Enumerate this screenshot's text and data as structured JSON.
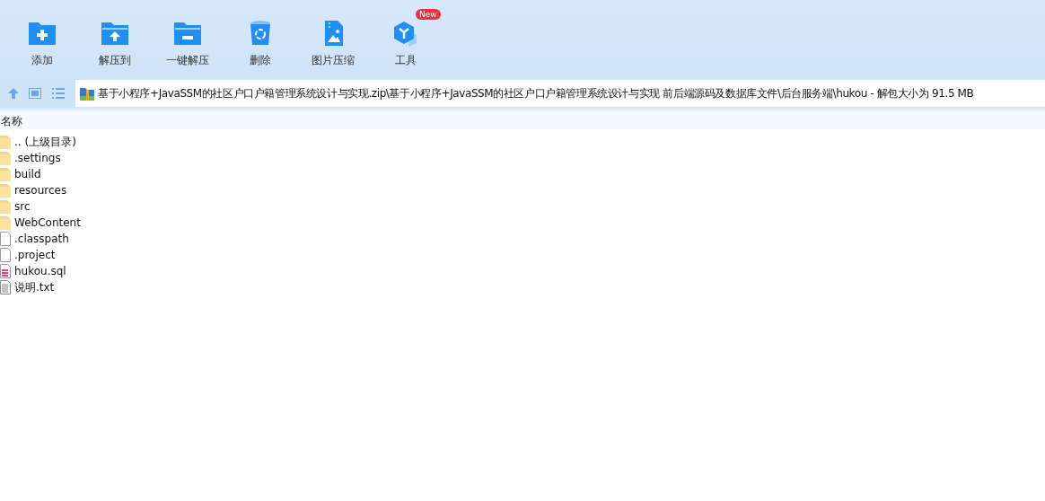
{
  "toolbar": [
    {
      "label": "添加",
      "kind": "add"
    },
    {
      "label": "解压到",
      "kind": "extract"
    },
    {
      "label": "一键解压",
      "kind": "oneclick"
    },
    {
      "label": "删除",
      "kind": "delete"
    },
    {
      "label": "图片压缩",
      "kind": "image"
    },
    {
      "label": "工具",
      "kind": "tools",
      "badge": "New"
    }
  ],
  "address": {
    "path": "基于小程序+JavaSSM的社区户口户籍管理系统设计与实现.zip\\基于小程序+JavaSSM的社区户口户籍管理系统设计与实现 前后端源码及数据库文件\\后台服务端\\hukou - 解包大小为 91.5 MB"
  },
  "table": {
    "columns": [
      "名称"
    ],
    "rows": [
      {
        "name": ".. (上级目录)",
        "kind": "folder"
      },
      {
        "name": ".settings",
        "kind": "folder"
      },
      {
        "name": "build",
        "kind": "folder"
      },
      {
        "name": "resources",
        "kind": "folder"
      },
      {
        "name": "src",
        "kind": "folder"
      },
      {
        "name": "WebContent",
        "kind": "folder"
      },
      {
        "name": ".classpath",
        "kind": "file"
      },
      {
        "name": ".project",
        "kind": "file"
      },
      {
        "name": "hukou.sql",
        "kind": "sql"
      },
      {
        "name": "说明.txt",
        "kind": "text"
      }
    ]
  }
}
